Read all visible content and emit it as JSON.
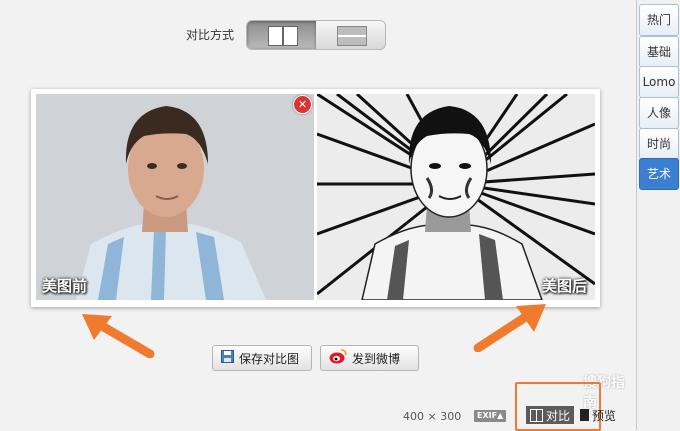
{
  "toolbar": {
    "compare_mode_label": "对比方式"
  },
  "photos": {
    "before_label": "美图前",
    "after_label": "美图后"
  },
  "actions": {
    "save_label": "保存对比图",
    "weibo_label": "发到微博"
  },
  "status": {
    "dimensions": "400 × 300",
    "exif": "EXIF▲",
    "compare_label": "对比",
    "preview_label": "预览"
  },
  "watermark": "搜狗指南",
  "side_tabs": [
    {
      "label": "热门"
    },
    {
      "label": "基础"
    },
    {
      "label": "Lomo"
    },
    {
      "label": "人像"
    },
    {
      "label": "时尚"
    },
    {
      "label": "艺术"
    }
  ],
  "colors": {
    "accent": "#3a7fd0",
    "annotation": "#f07a2d",
    "close": "#dd3333"
  }
}
